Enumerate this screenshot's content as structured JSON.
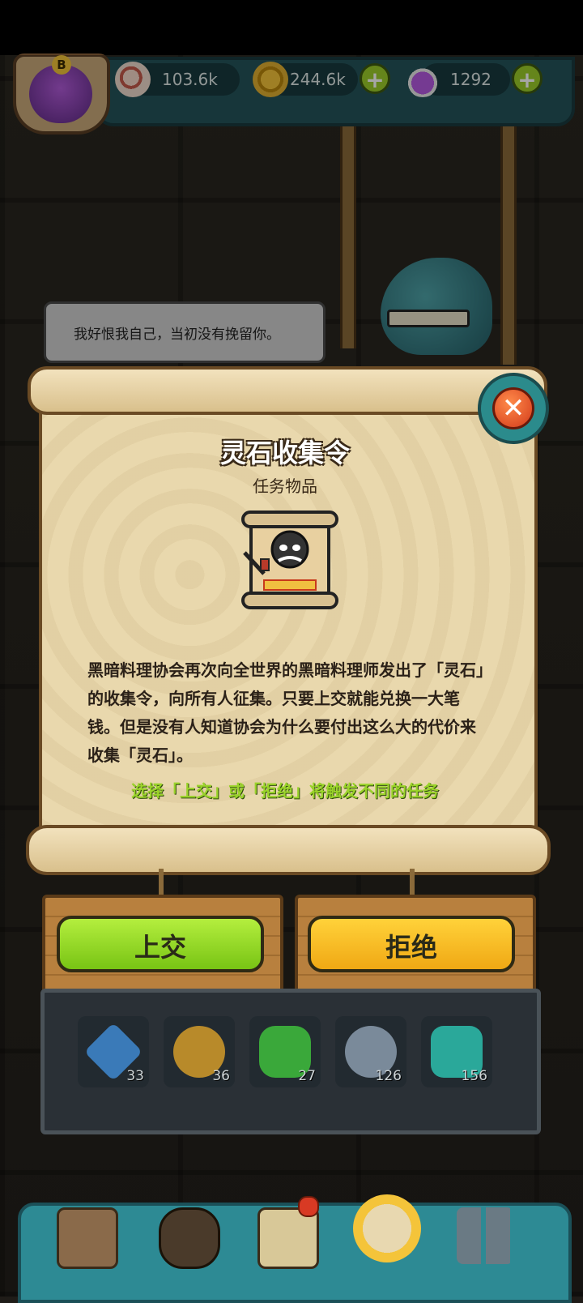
{
  "resources": {
    "eyeball": {
      "icon": "eyeball-icon",
      "value": "103.6k"
    },
    "gold": {
      "icon": "gold-coin-icon",
      "value": "244.6k"
    },
    "potion": {
      "icon": "potion-icon",
      "value": "1292"
    },
    "plus_label": "+"
  },
  "player": {
    "rank_badge": "B"
  },
  "npc": {
    "speech": "我好恨我自己，当初没有挽留你。"
  },
  "dialog": {
    "close_label": "✕",
    "title": "灵石收集令",
    "subtitle": "任务物品",
    "item_icon": "wanted-scroll-icon",
    "description": "黑暗料理协会再次向全世界的黑暗料理师发出了「灵石」的收集令，向所有人征集。只要上交就能兑换一大笔钱。但是没有人知道协会为什么要付出这么大的代价来收集「灵石」。",
    "hint": "选择「上交」或「拒绝」将触发不同的任务",
    "accept_label": "上交",
    "reject_label": "拒绝"
  },
  "inventory": [
    {
      "icon": "blue-gem-icon",
      "count": "33",
      "color": "#3a7ab8"
    },
    {
      "icon": "gold-gem-icon",
      "count": "36",
      "color": "#b88a2a"
    },
    {
      "icon": "green-gem-icon",
      "count": "27",
      "color": "#3aa83a"
    },
    {
      "icon": "coin-stack-icon",
      "count": "126",
      "color": "#7a8a9a"
    },
    {
      "icon": "spirit-creature-icon",
      "count": "156",
      "color": "#2aa89a"
    }
  ],
  "nav": [
    {
      "icon": "shop-building-icon"
    },
    {
      "icon": "kitchen-stove-icon"
    },
    {
      "icon": "recipe-book-icon"
    },
    {
      "icon": "money-bag-icon"
    },
    {
      "icon": "grid-menu-icon"
    }
  ]
}
